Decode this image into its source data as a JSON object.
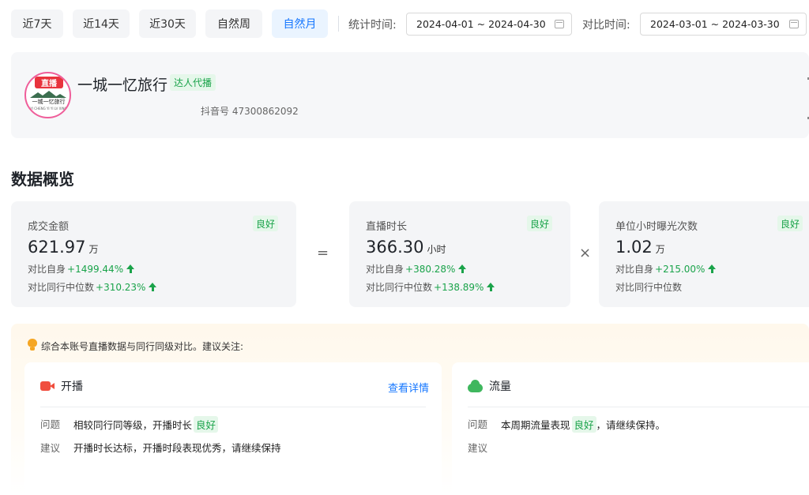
{
  "quick_ranges": [
    {
      "label": "近7天"
    },
    {
      "label": "近14天"
    },
    {
      "label": "近30天"
    },
    {
      "label": "自然周"
    },
    {
      "label": "自然月",
      "active": true
    }
  ],
  "stat_time": {
    "label": "统计时间:",
    "value": "2024-04-01 ~ 2024-04-30"
  },
  "compare_time": {
    "label": "对比时间:",
    "value": "2024-03-01 ~ 2024-03-30"
  },
  "account": {
    "name": "一城一忆旅行",
    "tag": "达人代播",
    "id": "抖音号 47300862092",
    "avatar": {
      "badge": "直播",
      "name": "一城一忆旅行",
      "sub": "YI CHENG YI YI LV XING"
    }
  },
  "overview": {
    "title": "数据概览",
    "operators": {
      "equals": "=",
      "times": "×"
    },
    "metrics": [
      {
        "label": "成交金额",
        "tag": "良好",
        "value": "621.97",
        "unit": "万",
        "self_label": "对比自身",
        "self_delta": "+1499.44%",
        "peer_label": "对比同行中位数",
        "peer_delta": "+310.23%"
      },
      {
        "label": "直播时长",
        "tag": "良好",
        "value": "366.30",
        "unit": "小时",
        "self_label": "对比自身",
        "self_delta": "+380.28%",
        "peer_label": "对比同行中位数",
        "peer_delta": "+138.89%"
      },
      {
        "label": "单位小时曝光次数",
        "tag": "良好",
        "value": "1.02",
        "unit": "万",
        "self_label": "对比自身",
        "self_delta": "+215.00%",
        "peer_label": "对比同行中位数",
        "peer_delta": ""
      }
    ]
  },
  "suggestions": {
    "title": "综合本账号直播数据与同行同级对比。建议关注:",
    "cards": [
      {
        "icon": "live-camera-icon",
        "title": "开播",
        "link": "查看详情",
        "problem_key": "问题",
        "problem_text": "相较同行同等级，开播时长",
        "problem_tag": "良好",
        "problem_suffix": "",
        "advice_key": "建议",
        "advice_text": "开播时长达标，开播时段表现优秀，请继续保持"
      },
      {
        "icon": "traffic-icon",
        "title": "流量",
        "problem_key": "问题",
        "problem_text": "本周期流量表现",
        "problem_tag": "良好",
        "problem_suffix": "，请继续保持。",
        "advice_key": "建议",
        "advice_text": ""
      }
    ]
  },
  "colors": {
    "accent": "#1677ff",
    "good": "#1aa34a",
    "good_bg": "#e5f7ea",
    "live_red": "#e8333d"
  }
}
